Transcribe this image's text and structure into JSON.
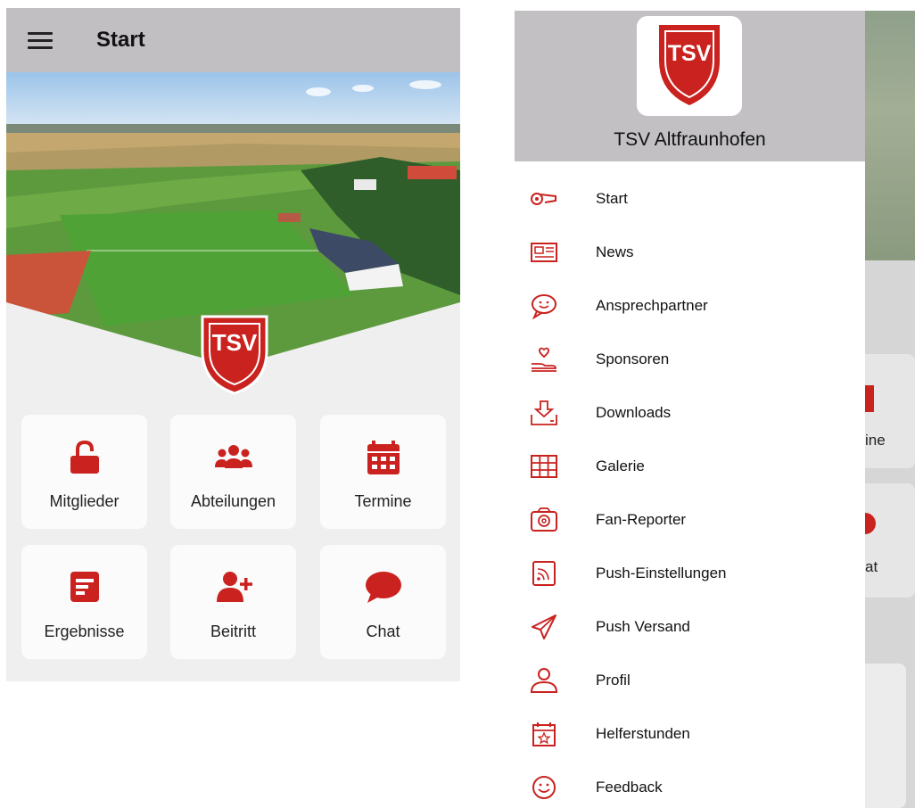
{
  "left": {
    "title": "Start",
    "tiles": [
      {
        "label": "Mitglieder",
        "icon": "lock-open-icon"
      },
      {
        "label": "Abteilungen",
        "icon": "users-icon"
      },
      {
        "label": "Termine",
        "icon": "calendar-icon"
      },
      {
        "label": "Ergebnisse",
        "icon": "results-icon"
      },
      {
        "label": "Beitritt",
        "icon": "user-plus-icon"
      },
      {
        "label": "Chat",
        "icon": "chat-bubble-icon"
      }
    ],
    "logo_text": "TSV"
  },
  "drawer": {
    "title": "TSV Altfraunhofen",
    "logo_text": "TSV",
    "items": [
      {
        "label": "Start",
        "icon": "whistle-icon"
      },
      {
        "label": "News",
        "icon": "newspaper-icon"
      },
      {
        "label": "Ansprechpartner",
        "icon": "chat-smile-icon"
      },
      {
        "label": "Sponsoren",
        "icon": "hand-heart-icon"
      },
      {
        "label": "Downloads",
        "icon": "download-icon"
      },
      {
        "label": "Galerie",
        "icon": "grid-icon"
      },
      {
        "label": "Fan-Reporter",
        "icon": "camera-icon"
      },
      {
        "label": "Push-Einstellungen",
        "icon": "rss-icon"
      },
      {
        "label": "Push Versand",
        "icon": "send-icon"
      },
      {
        "label": "Profil",
        "icon": "profile-icon"
      },
      {
        "label": "Helferstunden",
        "icon": "calendar-star-icon"
      },
      {
        "label": "Feedback",
        "icon": "smiley-icon"
      }
    ]
  },
  "background": {
    "fragment_1": "ine",
    "fragment_2": "at"
  },
  "colors": {
    "brand_red": "#c9221f",
    "appbar_gray": "#c2bfc3"
  }
}
